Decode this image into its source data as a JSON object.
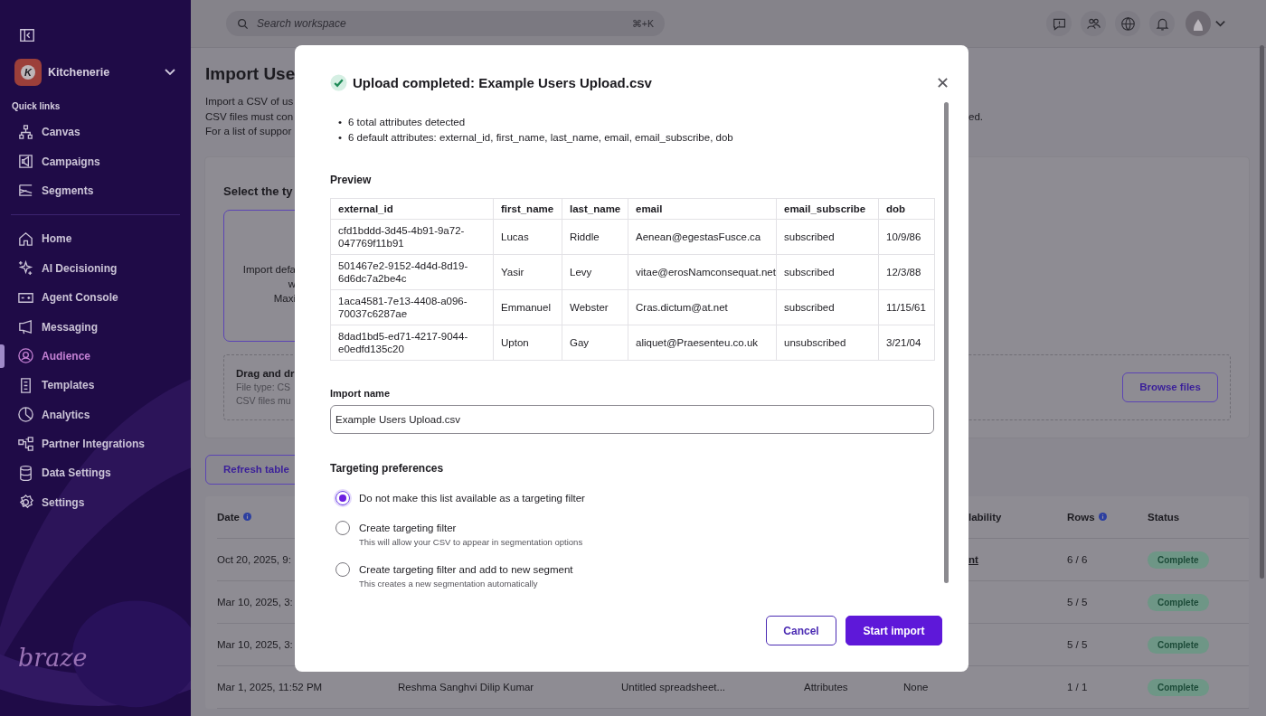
{
  "sidebar": {
    "workspace": {
      "initial": "K",
      "name": "Kitchenerie"
    },
    "quick_links_title": "Quick links",
    "quick_links": [
      {
        "label": "Canvas",
        "selected": false
      },
      {
        "label": "Campaigns",
        "selected": false
      },
      {
        "label": "Segments",
        "selected": false
      }
    ],
    "nav": [
      {
        "label": "Home",
        "selected": false
      },
      {
        "label": "AI Decisioning",
        "selected": false
      },
      {
        "label": "Agent Console",
        "selected": false
      },
      {
        "label": "Messaging",
        "selected": false
      },
      {
        "label": "Audience",
        "selected": true
      },
      {
        "label": "Templates",
        "selected": false
      },
      {
        "label": "Analytics",
        "selected": false
      },
      {
        "label": "Partner Integrations",
        "selected": false
      },
      {
        "label": "Data Settings",
        "selected": false
      },
      {
        "label": "Settings",
        "selected": false
      }
    ],
    "logo": "braze"
  },
  "topbar": {
    "search": {
      "placeholder": "Search workspace",
      "shortcut": "⌘+K"
    }
  },
  "page": {
    "title": "Import Use",
    "description": [
      {
        "left": "Import a CSV of us"
      },
      {
        "left": "CSV files must con",
        "right": "ed."
      },
      {
        "left": "For a list of suppor"
      }
    ],
    "upload_panel": {
      "title": "Select the ty",
      "option": {
        "lines": [
          "Import defa",
          "w",
          "Maxi"
        ],
        "selected": true
      },
      "dropzone": {
        "title": "Drag and dr",
        "lines": [
          "File type: CS",
          "CSV files mu"
        ],
        "button": "Browse files"
      }
    },
    "refresh_button": "Refresh table",
    "imports_table": {
      "columns": [
        {
          "label": "Date",
          "info": true
        },
        {
          "label": "lability",
          "info": false
        },
        {
          "label": "Rows",
          "info": true
        },
        {
          "label": "Status",
          "info": false
        }
      ],
      "rows": [
        {
          "date": "Oct 20, 2025, 9:",
          "availability": {
            "text": "nt",
            "link": true
          },
          "rows": "6 / 6",
          "status": "Complete"
        },
        {
          "date": "Mar 10, 2025, 3:",
          "rows": "5 / 5",
          "status": "Complete"
        },
        {
          "date": "Mar 10, 2025, 3:",
          "rows": "5 / 5",
          "status": "Complete"
        },
        {
          "date": "Mar 1, 2025, 11:52 PM",
          "name": "Reshma Sanghvi Dilip Kumar",
          "file": "Untitled spreadsheet...",
          "type": "Attributes",
          "availability": {
            "text": "None",
            "link": false
          },
          "rows": "1 / 1",
          "status": "Complete"
        }
      ]
    }
  },
  "modal": {
    "title": "Upload completed: Example Users Upload.csv",
    "summary": {
      "bullet": "•",
      "items": [
        "6 total attributes detected",
        "6 default attributes: external_id, first_name, last_name, email, email_subscribe, dob"
      ]
    },
    "preview_title": "Preview",
    "preview": {
      "columns": [
        "external_id",
        "first_name",
        "last_name",
        "email",
        "email_subscribe",
        "dob"
      ],
      "rows": [
        [
          "cfd1bddd-3d45-4b91-9a72-047769f11b91",
          "Lucas",
          "Riddle",
          "Aenean@egestasFusce.ca",
          "subscribed",
          "10/9/86"
        ],
        [
          "501467e2-9152-4d4d-8d19-6d6dc7a2be4c",
          "Yasir",
          "Levy",
          "vitae@erosNamconsequat.net",
          "subscribed",
          "12/3/88"
        ],
        [
          "1aca4581-7e13-4408-a096-70037c6287ae",
          "Emmanuel",
          "Webster",
          "Cras.dictum@at.net",
          "subscribed",
          "11/15/61"
        ],
        [
          "8dad1bd5-ed71-4217-9044-e0edfd135c20",
          "Upton",
          "Gay",
          "aliquet@Praesenteu.co.uk",
          "unsubscribed",
          "3/21/04"
        ]
      ]
    },
    "import_name": {
      "label": "Import name",
      "value": "Example Users Upload.csv"
    },
    "targeting": {
      "title": "Targeting preferences",
      "options": [
        {
          "label": "Do not make this list available as a targeting filter",
          "selected": true
        },
        {
          "label": "Create targeting filter",
          "hint": "This will allow your CSV to appear in segmentation options",
          "selected": false
        },
        {
          "label": "Create targeting filter and add to new segment",
          "hint": "This creates a new segmentation automatically",
          "selected": false
        }
      ]
    },
    "buttons": [
      {
        "label": "Cancel",
        "kind": "secondary"
      },
      {
        "label": "Start import",
        "kind": "primary"
      }
    ]
  }
}
